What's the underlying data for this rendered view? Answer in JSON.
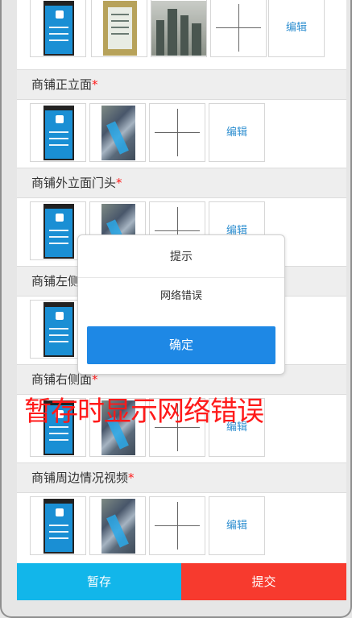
{
  "sections": [
    {
      "label": "商铺正立面",
      "required_mark": "*"
    },
    {
      "label": "商铺外立面门头",
      "required_mark": "*"
    },
    {
      "label": "商铺左侧面",
      "required_mark": "*"
    },
    {
      "label": "商铺右侧面",
      "required_mark": "*"
    },
    {
      "label": "商铺周边情况视频",
      "required_mark": "*"
    }
  ],
  "edit_label": "编辑",
  "dialog": {
    "title": "提示",
    "message": "网络错误",
    "confirm_label": "确定"
  },
  "annotation": "暂存时显示网络错误",
  "bottom_bar": {
    "save_label": "暂存",
    "submit_label": "提交"
  },
  "colors": {
    "save": "#12b6ea",
    "submit": "#f73a2e",
    "confirm": "#1e88e5",
    "edit_link": "#2f8fd0",
    "required": "#ff1a1a"
  }
}
